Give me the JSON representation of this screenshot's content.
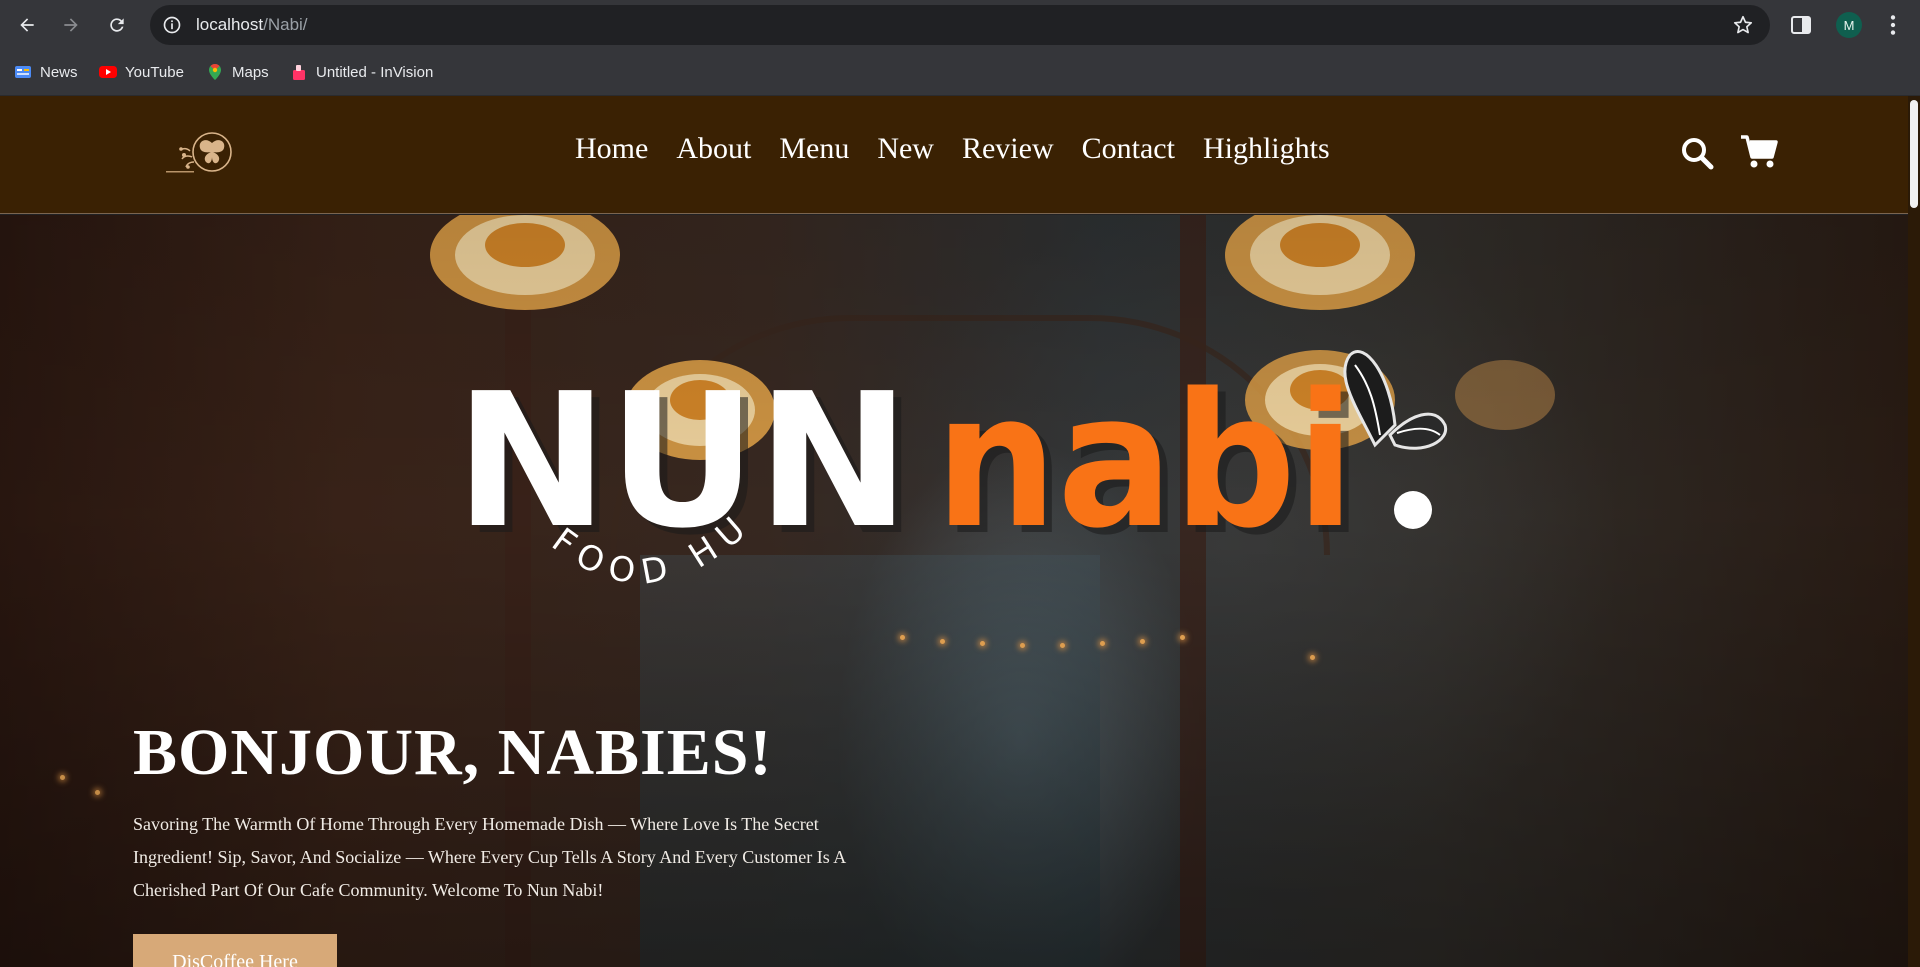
{
  "browser": {
    "url_host": "localhost",
    "url_path": "/Nabi/",
    "profile_initial": "M",
    "bookmarks": [
      {
        "label": "News",
        "icon": "news-icon"
      },
      {
        "label": "YouTube",
        "icon": "youtube-icon"
      },
      {
        "label": "Maps",
        "icon": "maps-icon"
      },
      {
        "label": "Untitled - InVision",
        "icon": "invision-icon"
      }
    ]
  },
  "site": {
    "nav": [
      "Home",
      "About",
      "Menu",
      "New",
      "Review",
      "Contact",
      "Highlights"
    ],
    "brand": {
      "word1": "NUN",
      "word2": "nabi",
      "tagline": "FOOD HUB"
    },
    "hero": {
      "title": "BONJOUR, NABIES!",
      "text": "Savoring The Warmth Of Home Through Every Homemade Dish — Where Love Is The Secret Ingredient! Sip, Savor, And Socialize — Where Every Cup Tells A Story And Every Customer Is A Cherished Part Of Our Cafe Community. Welcome To Nun Nabi!",
      "cta": "DisCoffee Here"
    }
  },
  "colors": {
    "header_bg": "#3a2103",
    "brand_orange": "#f97316",
    "cta_bg": "#d7a978"
  }
}
